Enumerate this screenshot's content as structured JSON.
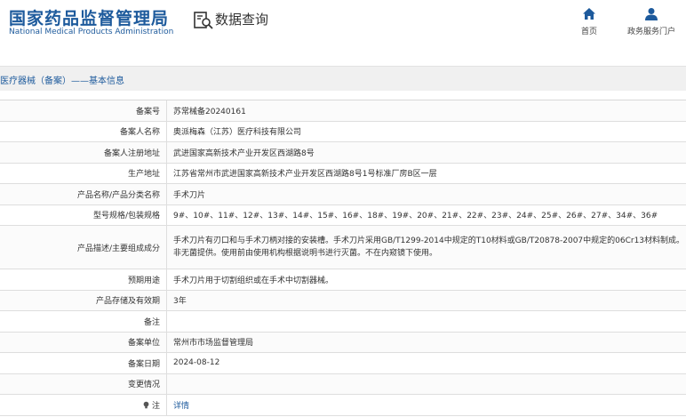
{
  "header": {
    "logo_cn": "国家药品监督管理局",
    "logo_en": "National Medical Products Administration",
    "search_title": "数据查询",
    "nav": [
      {
        "label": "首页",
        "icon": "home-icon"
      },
      {
        "label": "政务服务门户",
        "icon": "user-icon"
      }
    ]
  },
  "breadcrumb": "医疗器械（备案）——基本信息",
  "colors": {
    "brand": "#1d5a9c",
    "crumb_bg": "#f0f0f0",
    "border": "#dedede"
  },
  "rows": [
    {
      "label": "备案号",
      "value": "苏常械备20240161"
    },
    {
      "label": "备案人名称",
      "value": "奥派梅森（江苏）医疗科技有限公司"
    },
    {
      "label": "备案人注册地址",
      "value": "武进国家高新技术产业开发区西湖路8号"
    },
    {
      "label": "生产地址",
      "value": "江苏省常州市武进国家高新技术产业开发区西湖路8号1号标准厂房B区一层"
    },
    {
      "label": "产品名称/产品分类名称",
      "value": "手术刀片"
    },
    {
      "label": "型号规格/包装规格",
      "value": "9#、10#、11#、12#、13#、14#、15#、16#、18#、19#、20#、21#、22#、23#、24#、25#、26#、27#、34#、36#"
    },
    {
      "label": "产品描述/主要组成成分",
      "value": "手术刀片有刃口和与手术刀柄对接的安装槽。手术刀片采用GB/T1299-2014中规定的T10材料或GB/T20878-2007中规定的06Cr13材料制成。非无菌提供。使用前由使用机构根据说明书进行灭菌。不在内窥镜下使用。"
    },
    {
      "label": "预期用途",
      "value": "手术刀片用于切割组织或在手术中切割器械。"
    },
    {
      "label": "产品存储及有效期",
      "value": "3年"
    },
    {
      "label": "备注",
      "value": ""
    },
    {
      "label": "备案单位",
      "value": "常州市市场监督管理局"
    },
    {
      "label": "备案日期",
      "value": "2024-08-12"
    },
    {
      "label": "变更情况",
      "value": ""
    },
    {
      "label": "注",
      "value": "详情"
    }
  ]
}
